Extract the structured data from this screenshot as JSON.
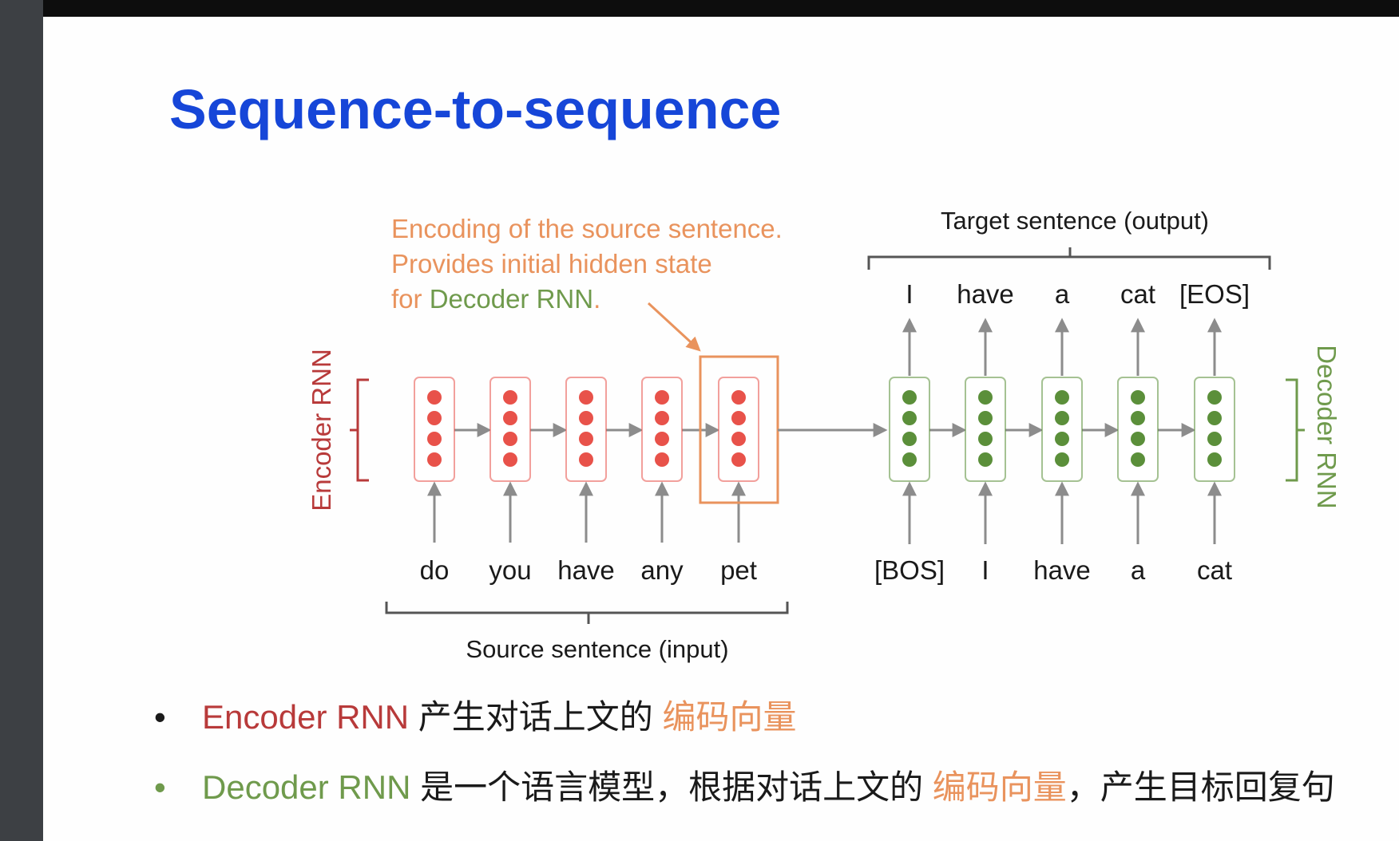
{
  "slide": {
    "title": "Sequence-to-sequence"
  },
  "diagram": {
    "annotation": {
      "line1": "Encoding of the source sentence.",
      "line2": "Provides initial hidden state",
      "line3_prefix": "for ",
      "line3_highlight": "Decoder RNN",
      "line3_suffix": "."
    },
    "encoder_label": "Encoder RNN",
    "decoder_label": "Decoder RNN",
    "source_label": "Source sentence (input)",
    "target_label": "Target sentence (output)",
    "source_words": [
      "do",
      "you",
      "have",
      "any",
      "pet"
    ],
    "decoder_inputs": [
      "[BOS]",
      "I",
      "have",
      "a",
      "cat"
    ],
    "decoder_outputs": [
      "I",
      "have",
      "a",
      "cat",
      "[EOS]"
    ],
    "colors": {
      "encoder": "#e8524a",
      "decoder": "#5b8f3a",
      "highlight": "#e9935d",
      "arrow": "#8c8c8c"
    }
  },
  "bullets": [
    {
      "dot": "•",
      "term": "Encoder RNN",
      "text1": " 产生对话上文的 ",
      "highlight": "编码向量",
      "text2": ""
    },
    {
      "dot": "•",
      "term": "Decoder RNN",
      "text1": " 是一个语言模型，根据对话上文的 ",
      "highlight": "编码向量",
      "text2": "，产生目标回复句"
    }
  ]
}
